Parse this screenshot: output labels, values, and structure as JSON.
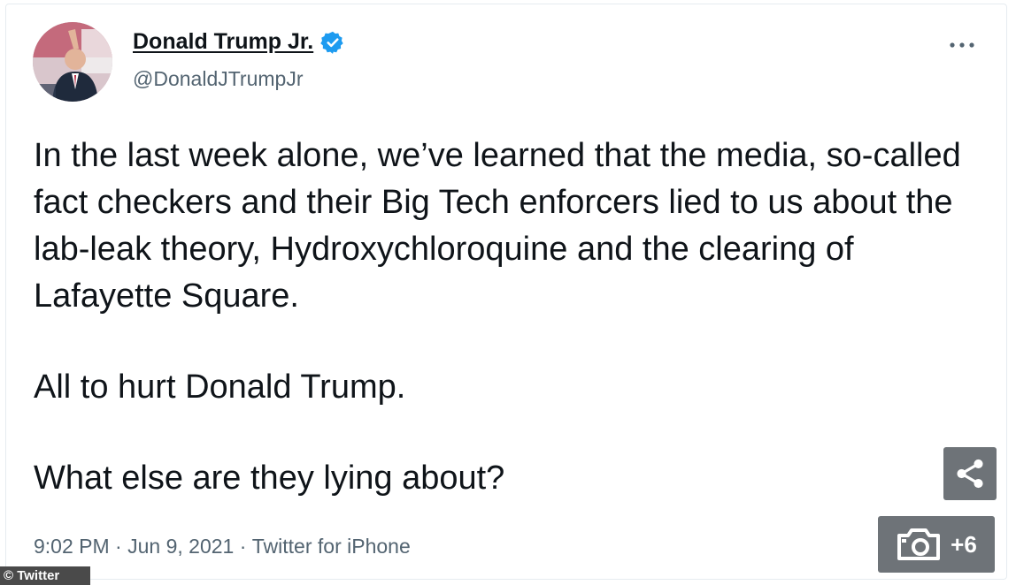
{
  "tweet": {
    "author_name": "Donald Trump Jr.",
    "handle": "@DonaldJTrumpJr",
    "more_icon": "more-horizontal-icon",
    "paragraphs": [
      "In the last week alone, we’ve learned that the media, so-called fact checkers and their Big Tech enforcers lied to us about the lab-leak theory, Hydroxychloroquine and the clearing of Lafayette Square.",
      "All to hurt Donald Trump.",
      "What else are they lying about?"
    ],
    "time": "9:02 PM",
    "separator": " · ",
    "date": "Jun 9, 2021",
    "source": "Twitter for iPhone"
  },
  "overlay": {
    "credit": "© Twitter",
    "gallery_count": "+6",
    "share_icon": "share-icon",
    "camera_icon": "camera-icon"
  },
  "colors": {
    "verified_blue": "#1d9bf0",
    "secondary_text": "#536471",
    "overlay_button": "#6e7378"
  }
}
